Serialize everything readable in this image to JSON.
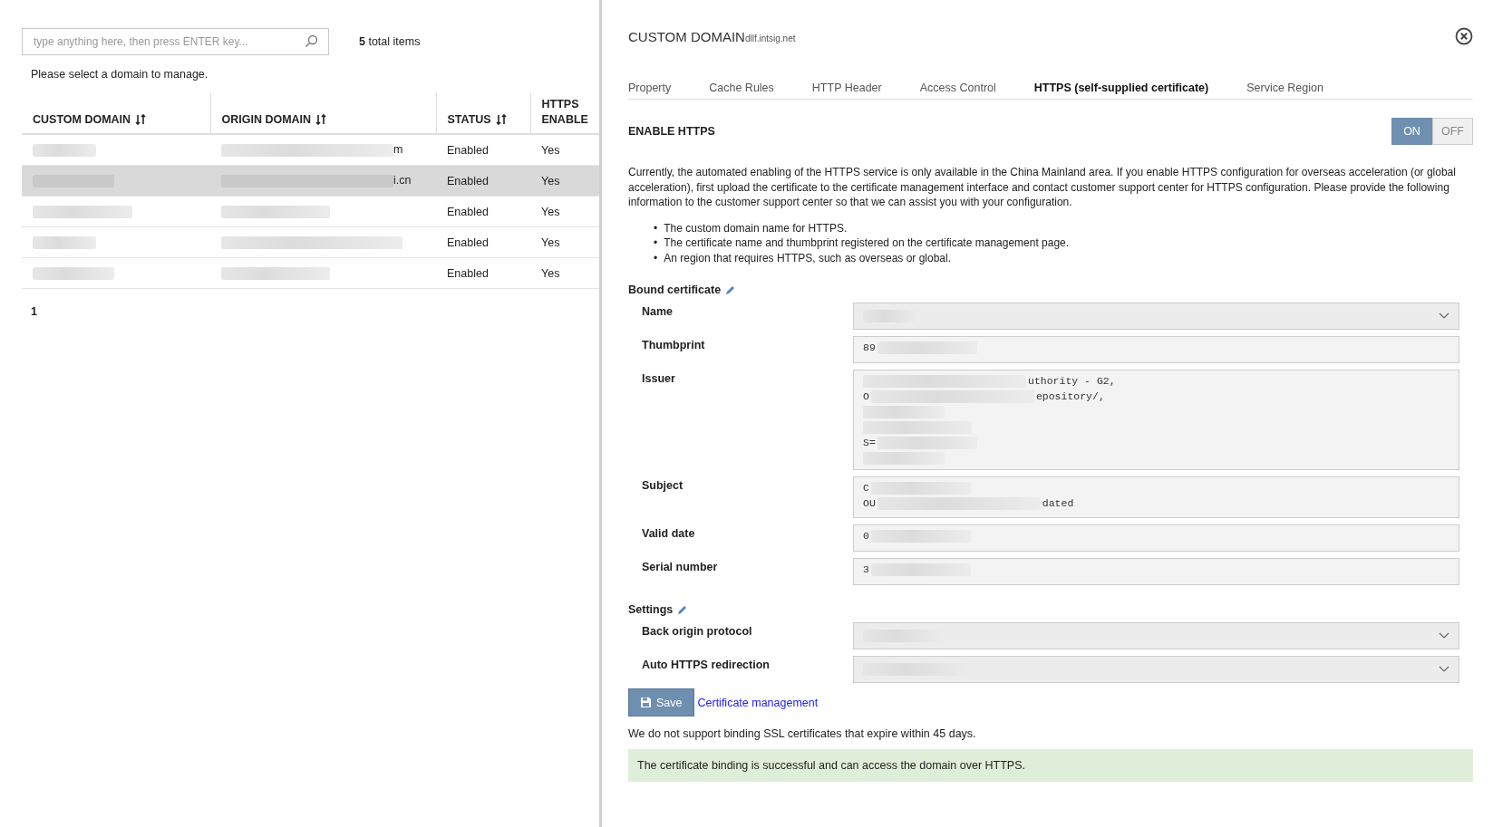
{
  "search": {
    "placeholder": "type anything here, then press ENTER key..."
  },
  "total_items": {
    "count": "5",
    "label": "total items"
  },
  "hint": "Please select a domain to manage.",
  "table": {
    "columns": [
      {
        "label": "CUSTOM DOMAIN",
        "sortable": true
      },
      {
        "label": "ORIGIN DOMAIN",
        "sortable": true
      },
      {
        "label": "STATUS",
        "sortable": true
      },
      {
        "label": "HTTPS ENABLE",
        "sortable": false
      }
    ],
    "rows": [
      {
        "custom_domain": {
          "kind": "redacted"
        },
        "origin_domain": {
          "kind": "partial",
          "end": "m"
        },
        "status": "Enabled",
        "https_enabled": "Yes",
        "selected": false
      },
      {
        "custom_domain": {
          "kind": "redacted"
        },
        "origin_domain": {
          "kind": "partial",
          "end": "i.cn"
        },
        "status": "Enabled",
        "https_enabled": "Yes",
        "selected": true
      },
      {
        "custom_domain": {
          "kind": "redacted"
        },
        "origin_domain": {
          "kind": "redacted"
        },
        "status": "Enabled",
        "https_enabled": "Yes",
        "selected": false
      },
      {
        "custom_domain": {
          "kind": "redacted"
        },
        "origin_domain": {
          "kind": "redacted"
        },
        "status": "Enabled",
        "https_enabled": "Yes",
        "selected": false
      },
      {
        "custom_domain": {
          "kind": "redacted"
        },
        "origin_domain": {
          "kind": "redacted"
        },
        "status": "Enabled",
        "https_enabled": "Yes",
        "selected": false
      }
    ]
  },
  "pagination": [
    {
      "label": "1",
      "selected": true
    }
  ],
  "panel": {
    "title": "CUSTOM DOMAIN",
    "subtitle": "dllf.intsig.net",
    "tabs": [
      {
        "label": "Property",
        "selected": false
      },
      {
        "label": "Cache Rules",
        "selected": false
      },
      {
        "label": "HTTP Header",
        "selected": false
      },
      {
        "label": "Access Control",
        "selected": false
      },
      {
        "label": "HTTPS (self-supplied certificate)",
        "selected": true
      },
      {
        "label": "Service Region",
        "selected": false
      }
    ],
    "enable_https": {
      "label": "ENABLE HTTPS",
      "options": [
        {
          "label": "ON",
          "selected": true
        },
        {
          "label": "OFF",
          "selected": false
        }
      ]
    },
    "description": "Currently, the automated enabling of the HTTPS service is only available in the China Mainland area. If you enable HTTPS configuration for overseas acceleration (or global acceleration), first upload the certificate to the certificate management interface and contact customer support center for HTTPS configuration. Please provide the following information to the customer support center so that we can assist you with your configuration.",
    "requirements": [
      {
        "bullet": "•",
        "text": "The custom domain name for HTTPS."
      },
      {
        "bullet": "•",
        "text": "The certificate name and thumbprint registered on the certificate management page."
      },
      {
        "bullet": "•",
        "text": "An region that requires HTTPS, such as overseas or global."
      }
    ],
    "sections": [
      {
        "title": "Bound certificate",
        "fields": [
          {
            "label": "Name",
            "kind": "select",
            "lines": [
              {
                "kind": "redacted"
              }
            ]
          },
          {
            "label": "Thumbprint",
            "kind": "text",
            "lines": [
              {
                "kind": "partial",
                "start": "89"
              }
            ]
          },
          {
            "label": "Issuer",
            "kind": "multiline",
            "lines": [
              {
                "kind": "partial",
                "end": "uthority - G2,"
              },
              {
                "kind": "partial",
                "start": "O",
                "end": "epository/,"
              },
              {
                "kind": "redacted"
              },
              {
                "kind": "redacted"
              },
              {
                "kind": "partial",
                "start": "S="
              },
              {
                "kind": "redacted"
              }
            ]
          },
          {
            "label": "Subject",
            "kind": "multiline",
            "lines": [
              {
                "kind": "partial",
                "start": "C"
              },
              {
                "kind": "partial",
                "start": "OU",
                "end": "dated"
              }
            ]
          },
          {
            "label": "Valid date",
            "kind": "text",
            "lines": [
              {
                "kind": "partial",
                "start": "0"
              }
            ]
          },
          {
            "label": "Serial number",
            "kind": "text",
            "lines": [
              {
                "kind": "partial",
                "start": "3"
              }
            ]
          }
        ]
      },
      {
        "title": "Settings",
        "fields": [
          {
            "label": "Back origin protocol",
            "kind": "select",
            "lines": [
              {
                "kind": "redacted"
              }
            ]
          },
          {
            "label": "Auto HTTPS redirection",
            "kind": "select",
            "lines": [
              {
                "kind": "redacted"
              }
            ]
          }
        ]
      }
    ],
    "save_button": "Save",
    "certificate_link": "Certificate management",
    "note": "We do not support binding SSL certificates that expire within 45 days.",
    "alert": {
      "kind": "success",
      "text": "The certificate binding is successful and can access the domain over HTTPS."
    }
  }
}
